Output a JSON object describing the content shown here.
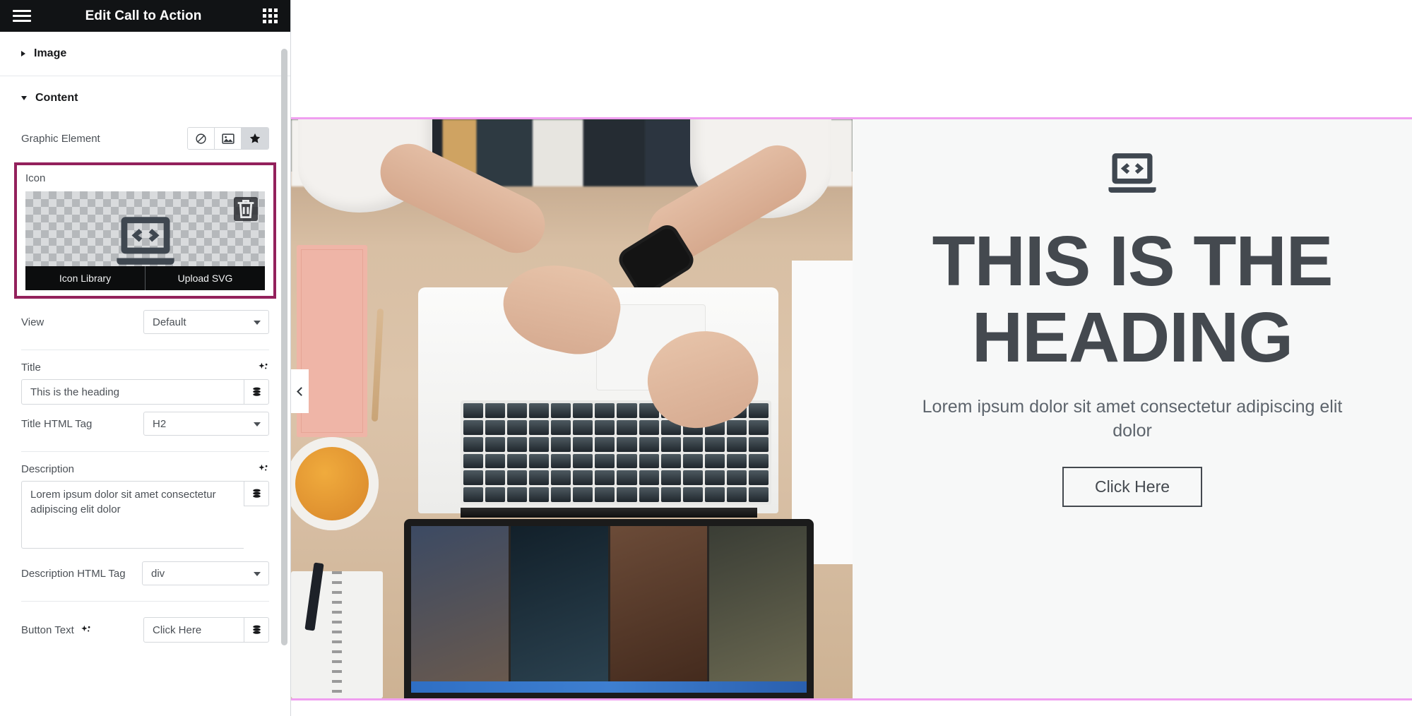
{
  "panel": {
    "title": "Edit Call to Action",
    "menu_icon": "hamburger-icon",
    "apps_icon": "grid-apps-icon"
  },
  "sections": [
    {
      "id": "image",
      "label": "Image",
      "expanded": false
    },
    {
      "id": "content",
      "label": "Content",
      "expanded": true
    }
  ],
  "controls": {
    "graphic_element": {
      "label": "Graphic Element",
      "options": [
        {
          "name": "none-icon",
          "selected": false
        },
        {
          "name": "image-icon",
          "selected": false
        },
        {
          "name": "star-icon",
          "selected": true
        }
      ]
    },
    "icon": {
      "label": "Icon",
      "preview_icon": "laptop-code-icon",
      "delete_icon": "trash-icon",
      "library_button": "Icon Library",
      "upload_button": "Upload SVG"
    },
    "view": {
      "label": "View",
      "value": "Default",
      "caret": "chevron-down-icon"
    },
    "title": {
      "label": "Title",
      "ai_icon": "sparkle-ai-icon",
      "value": "This is the heading",
      "dynamic_icon": "dynamic-tags-icon"
    },
    "title_html_tag": {
      "label": "Title HTML Tag",
      "value": "H2"
    },
    "description": {
      "label": "Description",
      "ai_icon": "sparkle-ai-icon",
      "value": "Lorem ipsum dolor sit amet consectetur adipiscing elit dolor",
      "dynamic_icon": "dynamic-tags-icon"
    },
    "description_html_tag": {
      "label": "Description HTML Tag",
      "value": "div"
    },
    "button_text": {
      "label": "Button Text",
      "ai_icon": "sparkle-ai-icon",
      "value": "Click Here",
      "dynamic_icon": "dynamic-tags-icon"
    }
  },
  "preview": {
    "collapse_icon": "chevron-left-icon",
    "photo_alt": "hands typing on a laptop on a wooden desk with notebook, pen and tea",
    "cta": {
      "icon": "laptop-code-icon",
      "title": "This is the heading",
      "description": "Lorem ipsum dolor sit amet consectetur adipiscing elit dolor",
      "button_label": "Click Here"
    }
  },
  "colors": {
    "header_bg": "#111315",
    "highlight_border": "#93215c",
    "section_rule": "#f09ff0",
    "cta_text": "#44494f",
    "cta_bg": "#f7f8f8"
  }
}
